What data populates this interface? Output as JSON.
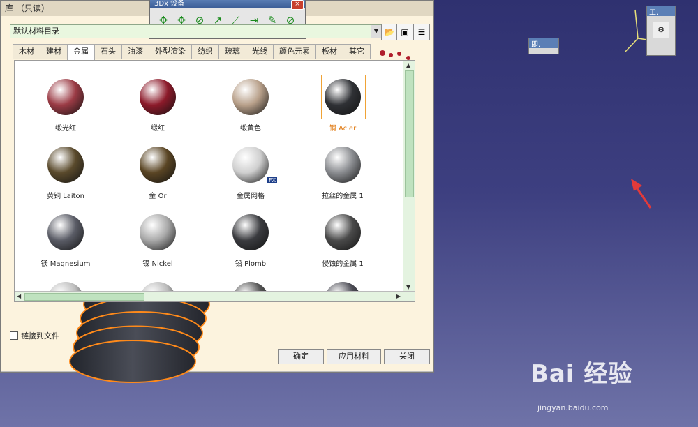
{
  "toolbar_3dx": {
    "title": "3Dx 设备",
    "close": "×",
    "icons": [
      "move-icon",
      "rotate-icon",
      "rotate-pause-icon",
      "pick-icon",
      "axis-icon",
      "ruler-icon",
      "snap-icon",
      "pause-icon"
    ]
  },
  "mini_windows": {
    "gong_title": "工.",
    "ji_title": "即."
  },
  "library": {
    "title": "库 （只读）",
    "catalog": "默认材料目录",
    "tabs": [
      "木材",
      "建材",
      "金属",
      "石头",
      "油漆",
      "外型渲染",
      "纺织",
      "玻璃",
      "光线",
      "颜色元素",
      "板材",
      "其它"
    ],
    "active_tab": "金属",
    "materials": [
      {
        "label": "缎光红",
        "color": "#9b3b45"
      },
      {
        "label": "缎红",
        "color": "#8c1a2a"
      },
      {
        "label": "缎黄色",
        "color": "#b8a08a"
      },
      {
        "label": "钢 Acier",
        "color": "#2f3135",
        "selected": true
      },
      {
        "label": "黄铜 Laiton",
        "color": "#5a4a2c"
      },
      {
        "label": "金 Or",
        "color": "#5a4524"
      },
      {
        "label": "金属网格",
        "color": "#cfcfcf",
        "badge": "FX"
      },
      {
        "label": "拉丝的金属 1",
        "color": "#8a8c90"
      },
      {
        "label": "镁 Magnesium",
        "color": "#5a5c66"
      },
      {
        "label": "镍 Nickel",
        "color": "#a9a9a9"
      },
      {
        "label": "铅 Plomb",
        "color": "#3a3b3f"
      },
      {
        "label": "侵蚀的金属 1",
        "color": "#4a4a4a"
      },
      {
        "label": "",
        "color": "#bdbdbd"
      },
      {
        "label": "",
        "color": "#bbbbbb"
      },
      {
        "label": "",
        "color": "#555555"
      },
      {
        "label": "",
        "color": "#4c4c55"
      }
    ],
    "link_to_file": "链接到文件",
    "buttons": {
      "ok": "确定",
      "apply": "应用材料",
      "close": "关闭"
    }
  },
  "watermark": {
    "text": "Bai 经验",
    "url": "jingyan.baidu.com"
  }
}
